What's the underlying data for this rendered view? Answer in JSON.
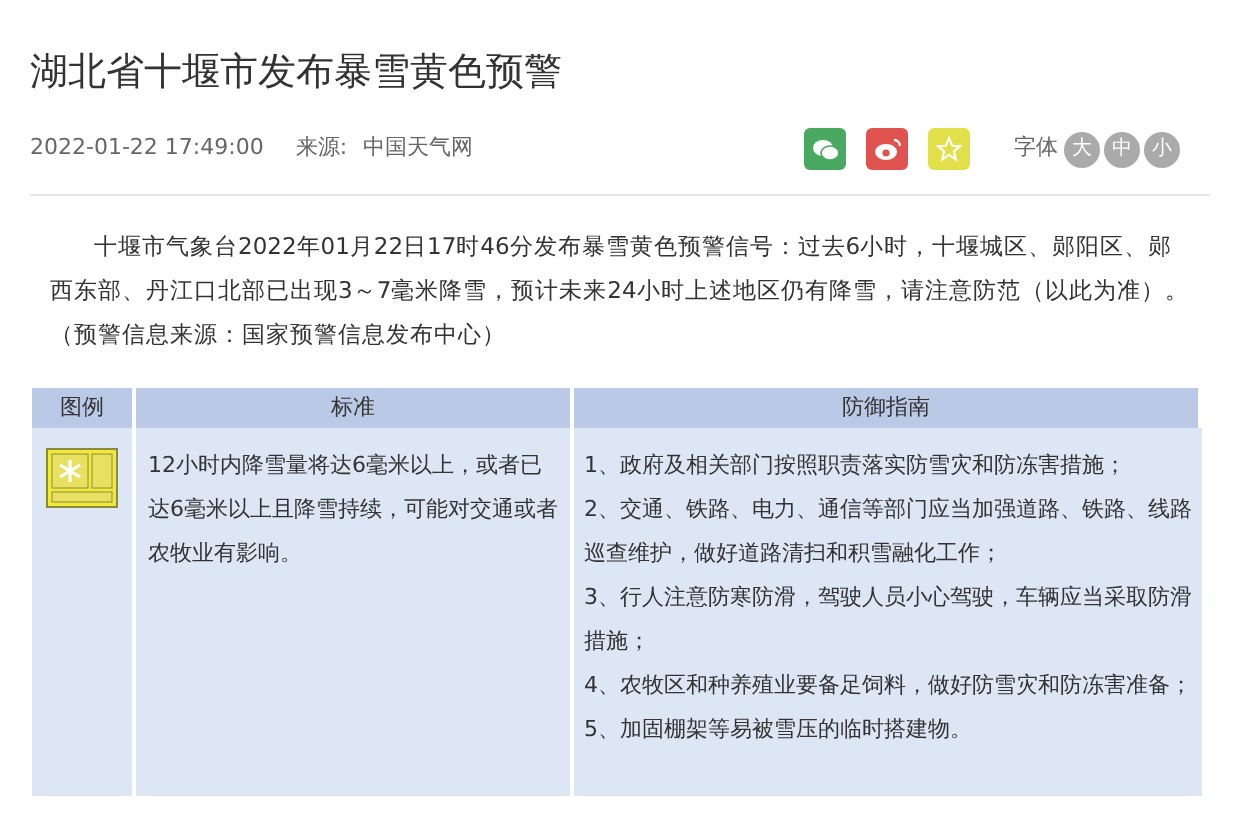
{
  "article": {
    "title": "湖北省十堰市发布暴雪黄色预警",
    "date": "2022-01-22 17:49:00",
    "source_label": "来源:",
    "source": "中国天气网",
    "font_label": "字体",
    "font_sizes": [
      {
        "label": "大",
        "selected": false
      },
      {
        "label": "中",
        "selected": false
      },
      {
        "label": "小",
        "selected": false
      }
    ],
    "share_buttons": [
      {
        "kind": "wechat",
        "color": "#4aa961"
      },
      {
        "kind": "weibo",
        "color": "#e0524e"
      },
      {
        "kind": "favorite",
        "color": "#e2e04a"
      }
    ],
    "paragraph": "十堰市气象台2022年01月22日17时46分发布暴雪黄色预警信号：过去6小时，十堰城区、郧阳区、郧西东部、丹江口北部已出现3～7毫米降雪，预计未来24小时上述地区仍有降雪，请注意防范（以此为准）。（预警信息来源：国家预警信息发布中心）"
  },
  "table": {
    "columns": [
      "图例",
      "标准",
      "防御指南"
    ],
    "standard": "12小时内降雪量将达6毫米以上，或者已达6毫米以上且降雪持续，可能对交通或者农牧业有影响。",
    "guidance": [
      "1、政府及相关部门按照职责落实防雪灾和防冻害措施；",
      "2、交通、铁路、电力、通信等部门应当加强道路、铁路、线路巡查维护，做好道路清扫和积雪融化工作；",
      "3、行人注意防寒防滑，驾驶人员小心驾驶，车辆应当采取防滑措施；",
      "4、农牧区和种养殖业要备足饲料，做好防雪灾和防冻害准备；",
      "5、加固棚架等易被雪压的临时搭建物。"
    ]
  }
}
